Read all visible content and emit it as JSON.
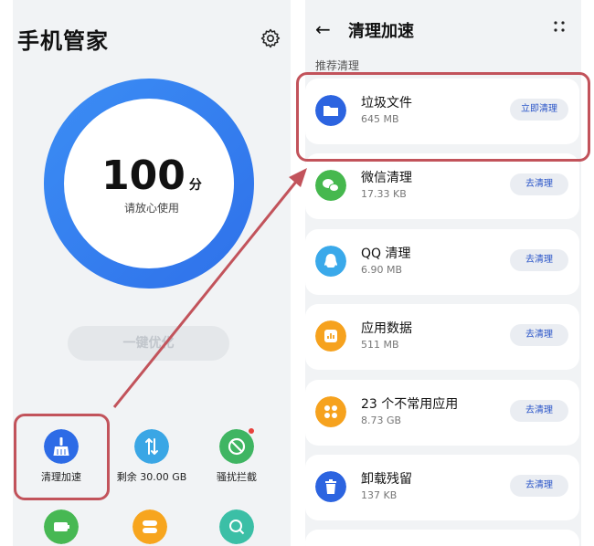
{
  "left": {
    "title": "手机管家",
    "score": "100",
    "score_unit": "分",
    "score_desc": "请放心使用",
    "optimize_button": "一键优化",
    "tiles": [
      {
        "label": "清理加速",
        "color": "#2d6be6",
        "icon": "broom-icon"
      },
      {
        "label": "剩余 30.00 GB",
        "color": "#3aa6e5",
        "icon": "storage-arrows-icon"
      },
      {
        "label": "骚扰拦截",
        "color": "#3fb562",
        "icon": "phone-block-icon"
      }
    ],
    "row2_icons": [
      {
        "color": "#47b853",
        "icon": "battery-icon"
      },
      {
        "color": "#f7a51e",
        "icon": "toggle-icon"
      },
      {
        "color": "#3bbfa6",
        "icon": "search-shield-icon"
      }
    ]
  },
  "right": {
    "title": "清理加速",
    "section_label": "推荐清理",
    "items": [
      {
        "title": "垃圾文件",
        "size": "645 MB",
        "button": "立即清理",
        "color": "#2c64e0",
        "icon": "folder-icon"
      },
      {
        "title": "微信清理",
        "size": "17.33 KB",
        "button": "去清理",
        "color": "#46b84e",
        "icon": "wechat-icon"
      },
      {
        "title": "QQ 清理",
        "size": "6.90 MB",
        "button": "去清理",
        "color": "#3aa9ea",
        "icon": "qq-icon"
      },
      {
        "title": "应用数据",
        "size": "511 MB",
        "button": "去清理",
        "color": "#f6a21e",
        "icon": "app-data-icon"
      },
      {
        "title": "23 个不常用应用",
        "size": "8.73 GB",
        "button": "去清理",
        "color": "#f6a21e",
        "icon": "apps-grid-icon"
      },
      {
        "title": "卸载残留",
        "size": "137 KB",
        "button": "去清理",
        "color": "#2c64e0",
        "icon": "trash-icon"
      }
    ]
  },
  "annotation_color": "#c2535b"
}
